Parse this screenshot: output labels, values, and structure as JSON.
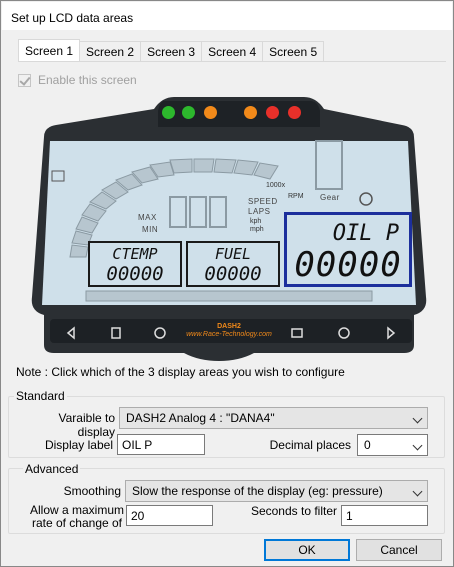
{
  "window": {
    "title": "Set up LCD data areas"
  },
  "tabs": [
    {
      "label": "Screen 1",
      "active": true
    },
    {
      "label": "Screen 2",
      "active": false
    },
    {
      "label": "Screen 3",
      "active": false
    },
    {
      "label": "Screen 4",
      "active": false
    },
    {
      "label": "Screen 5",
      "active": false
    }
  ],
  "enable_screen": {
    "label": "Enable this screen",
    "checked": true,
    "disabled": true
  },
  "dash": {
    "lights": {
      "green": "#2db82d",
      "orange": "#f28a1a",
      "red": "#e8302a"
    },
    "lcd_words": {
      "max": "MAX",
      "min": "MIN",
      "speed": "SPEED",
      "laps": "LAPS",
      "kph": "kph",
      "mph": "mph",
      "rpm_x": "1000x",
      "rpm": "RPM",
      "gear": "Gear"
    },
    "areas": [
      {
        "label": "CTEMP",
        "value": "00000",
        "selected": false
      },
      {
        "label": "FUEL",
        "value": "00000",
        "selected": false
      },
      {
        "label": "OIL P",
        "value": "00000",
        "selected": true
      }
    ],
    "brand": {
      "name": "DASH2",
      "site": "www.Race-Technology.com"
    },
    "colors": {
      "lcd": "#cfe0ea",
      "bezel": "#2b2f33",
      "selected_border": "#1c2f9c"
    }
  },
  "note": "Note : Click which of the 3 display areas you wish to configure",
  "standard": {
    "title": "Standard",
    "variable_label": "Varaible to display",
    "variable_value": "DASH2 Analog 4 : \"DANA4\"",
    "display_label_label": "Display label",
    "display_label_value": "OIL P",
    "decimal_label": "Decimal places",
    "decimal_value": "0"
  },
  "advanced": {
    "title": "Advanced",
    "smoothing_label": "Smoothing",
    "smoothing_value": "Slow the response of the display (eg: pressure)",
    "max_rate_label_1": "Allow a maximum",
    "max_rate_label_2": "rate of change of",
    "max_rate_value": "20",
    "seconds_label": "Seconds to filter",
    "seconds_value": "1"
  },
  "buttons": {
    "ok": "OK",
    "cancel": "Cancel"
  }
}
